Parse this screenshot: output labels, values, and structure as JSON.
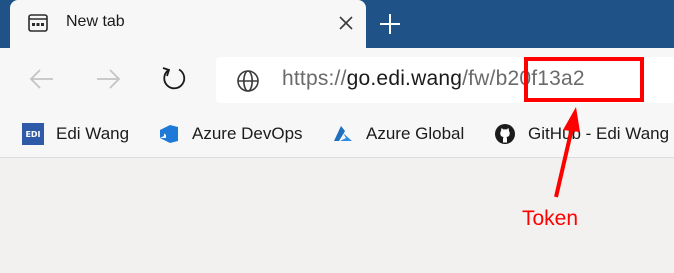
{
  "tab": {
    "title": "New tab",
    "favicon": "new-tab-page-icon",
    "close_icon": "close-icon"
  },
  "new_tab_icon": "plus-icon",
  "toolbar": {
    "back_icon": "back-arrow-icon",
    "forward_icon": "forward-arrow-icon",
    "refresh_icon": "refresh-icon"
  },
  "address": {
    "icon": "globe-icon",
    "url_scheme": "https://",
    "url_host": "go.edi.wang",
    "url_path": "/fw/",
    "url_token": "b20f13a2"
  },
  "bookmarks": [
    {
      "label": "Edi Wang",
      "icon": "edi-icon",
      "icon_text": "EDI"
    },
    {
      "label": "Azure DevOps",
      "icon": "azure-devops-icon"
    },
    {
      "label": "Azure Global",
      "icon": "azure-icon"
    },
    {
      "label": "GitHub - Edi Wang",
      "icon": "github-icon"
    }
  ],
  "annotation": {
    "label": "Token",
    "color": "#ff0000"
  },
  "colors": {
    "tabstrip": "#1f5286",
    "toolbar": "#f7f7f7",
    "page": "#f3f1ef",
    "annotation": "#ff0000"
  }
}
